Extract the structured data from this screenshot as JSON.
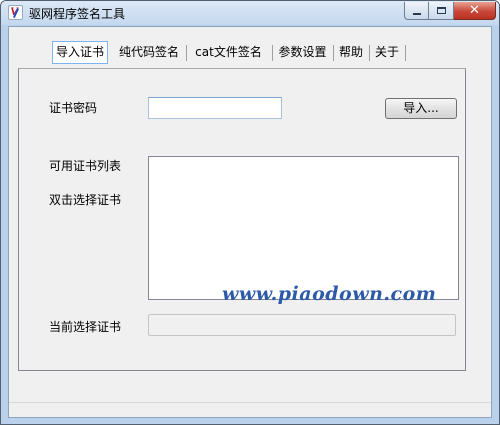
{
  "window": {
    "title": "驱网程序签名工具",
    "close_glyph": "✕"
  },
  "tabs": [
    {
      "label": "导入证书",
      "active": true
    },
    {
      "label": "纯代码签名",
      "active": false
    },
    {
      "label": "cat文件签名",
      "active": false
    },
    {
      "label": "参数设置",
      "active": false
    },
    {
      "label": "帮助",
      "active": false
    },
    {
      "label": "关于",
      "active": false
    }
  ],
  "import_panel": {
    "password_label": "证书密码",
    "password_value": "",
    "import_button": "导入...",
    "available_label": "可用证书列表",
    "double_click_hint": "双击选择证书",
    "current_label": "当前选择证书",
    "current_value": ""
  },
  "watermark": "www.piaodown.com",
  "colors": {
    "frame": "#b9d1ea",
    "tab_active_border": "#7eb4ea",
    "watermark": "#2c5aa8",
    "close_button": "#c9473a"
  }
}
